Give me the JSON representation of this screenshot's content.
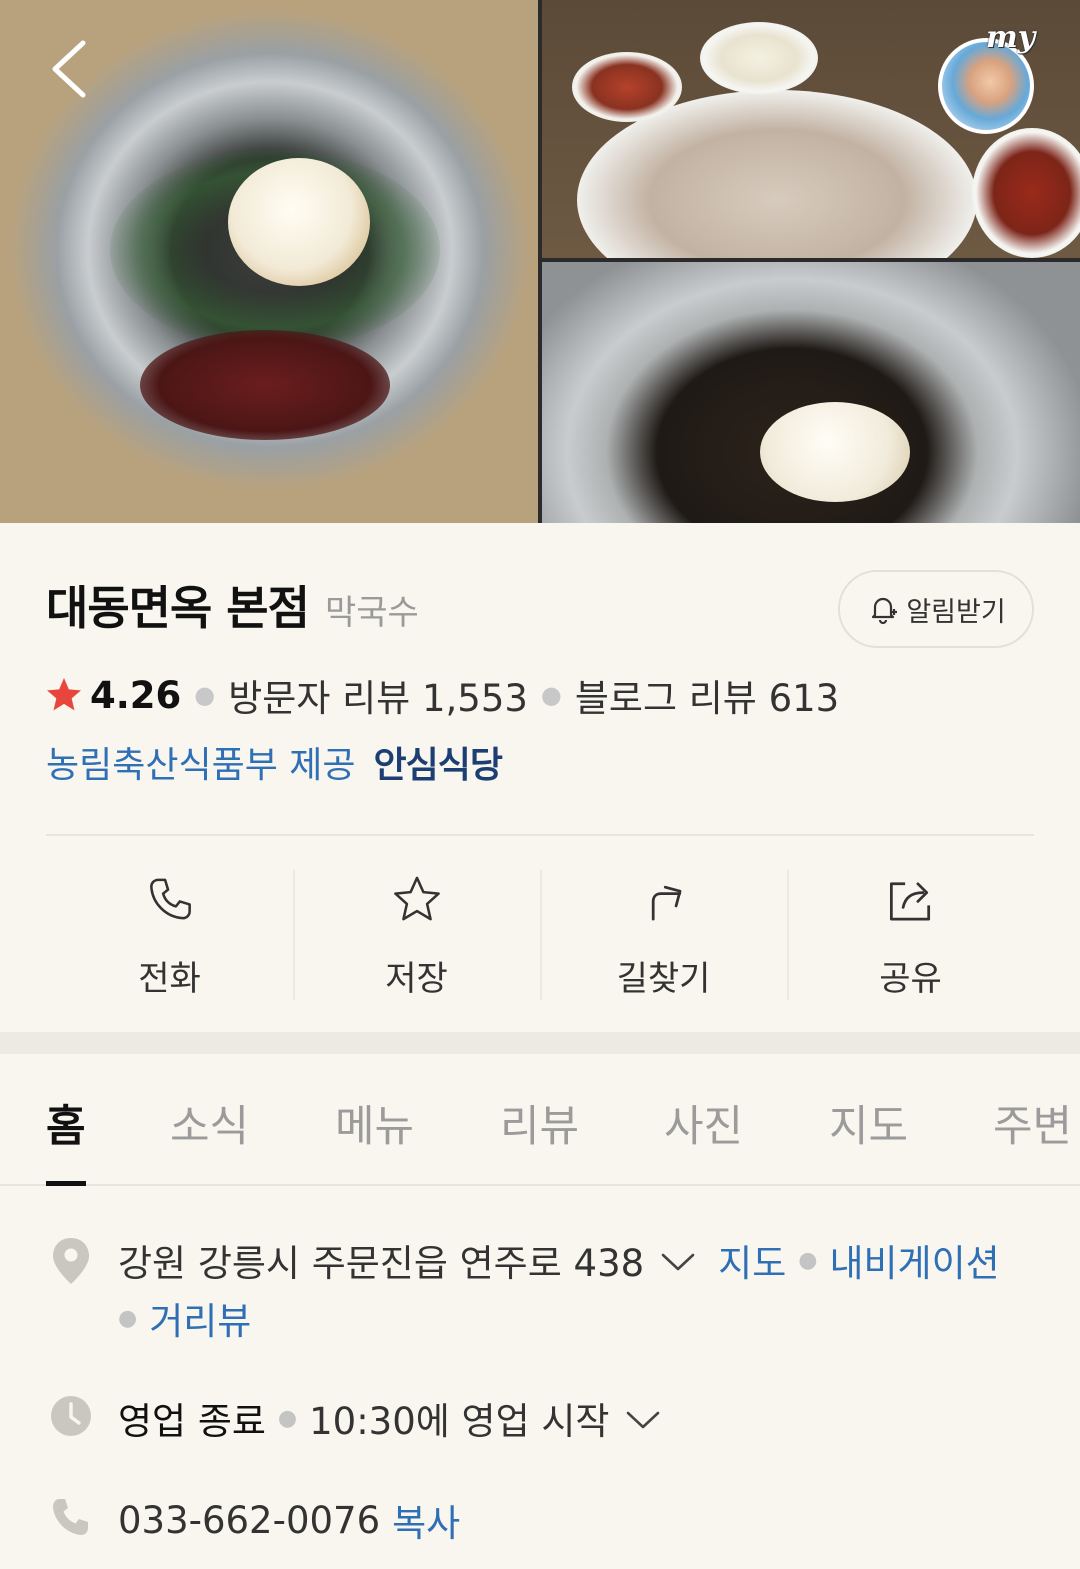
{
  "header": {
    "back_icon": "chevron-left-icon",
    "my_badge_text": "my"
  },
  "place": {
    "name": "대동면옥 본점",
    "category": "막국수",
    "alarm_label": "알림받기",
    "rating": "4.26",
    "visitor_review_label": "방문자 리뷰 1,553",
    "blog_review_label": "블로그 리뷰 613",
    "provider": "농림축산식품부 제공",
    "safe_badge": "안심식당"
  },
  "actions": [
    {
      "label": "전화",
      "icon": "phone-icon"
    },
    {
      "label": "저장",
      "icon": "star-icon"
    },
    {
      "label": "길찾기",
      "icon": "directions-icon"
    },
    {
      "label": "공유",
      "icon": "share-icon"
    }
  ],
  "tabs": [
    "홈",
    "소식",
    "메뉴",
    "리뷰",
    "사진",
    "지도",
    "주변"
  ],
  "active_tab": "홈",
  "info": {
    "address": "강원 강릉시 주문진읍 연주로 438",
    "map_link": "지도",
    "navigation_link": "내비게이션",
    "streetview_link": "거리뷰",
    "hours_status": "영업 종료",
    "hours_next": "10:30에 영업 시작",
    "phone": "033-662-0076",
    "copy_label": "복사"
  },
  "colors": {
    "background": "#f8f6ee",
    "link": "#2f6fb5",
    "star": "#e8453c",
    "safe_badge": "#1c3e73"
  }
}
